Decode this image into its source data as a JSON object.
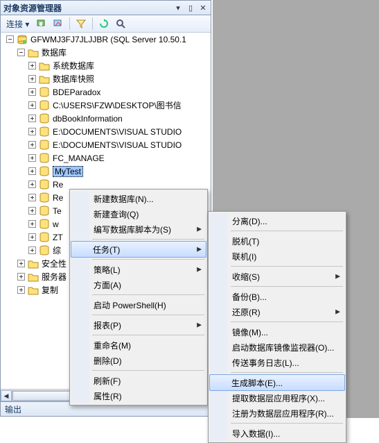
{
  "panel": {
    "title": "对象资源管理器",
    "connect_label": "连接 ▾"
  },
  "tree": {
    "server": "GFWMJ3FJ7JLJJBR (SQL Server 10.50.1",
    "db_root": "数据库",
    "sys_db": "系统数据库",
    "db_snap": "数据库快照",
    "items": [
      "BDEParadox",
      "C:\\USERS\\FZW\\DESKTOP\\图书信",
      "dbBookInformation",
      "E:\\DOCUMENTS\\VISUAL STUDIO",
      "E:\\DOCUMENTS\\VISUAL STUDIO",
      "FC_MANAGE"
    ],
    "selected": "MyTest",
    "partial": [
      "Re",
      "Re",
      "Te",
      "w",
      "ZT",
      "综"
    ],
    "security": "安全性",
    "server_obj": "服务器",
    "replication": "复制"
  },
  "output": {
    "label": "输出"
  },
  "menu1": {
    "new_db": "新建数据库(N)...",
    "new_query": "新建查询(Q)",
    "script_db": "编写数据库脚本为(S)",
    "tasks": "任务(T)",
    "policy": "策略(L)",
    "facets": "方面(A)",
    "ps": "启动 PowerShell(H)",
    "reports": "报表(P)",
    "rename": "重命名(M)",
    "delete": "删除(D)",
    "refresh": "刷新(F)",
    "props": "属性(R)"
  },
  "menu2": {
    "detach": "分离(D)...",
    "offline": "脱机(T)",
    "online": "联机(I)",
    "shrink": "收缩(S)",
    "backup": "备份(B)...",
    "restore": "还原(R)",
    "mirror": "镜像(M)...",
    "mirror_mon": "启动数据库镜像监视器(O)...",
    "ship_log": "传送事务日志(L)...",
    "gen_script": "生成脚本(E)...",
    "extract": "提取数据层应用程序(X)...",
    "register": "注册为数据层应用程序(R)...",
    "import": "导入数据(I)..."
  }
}
